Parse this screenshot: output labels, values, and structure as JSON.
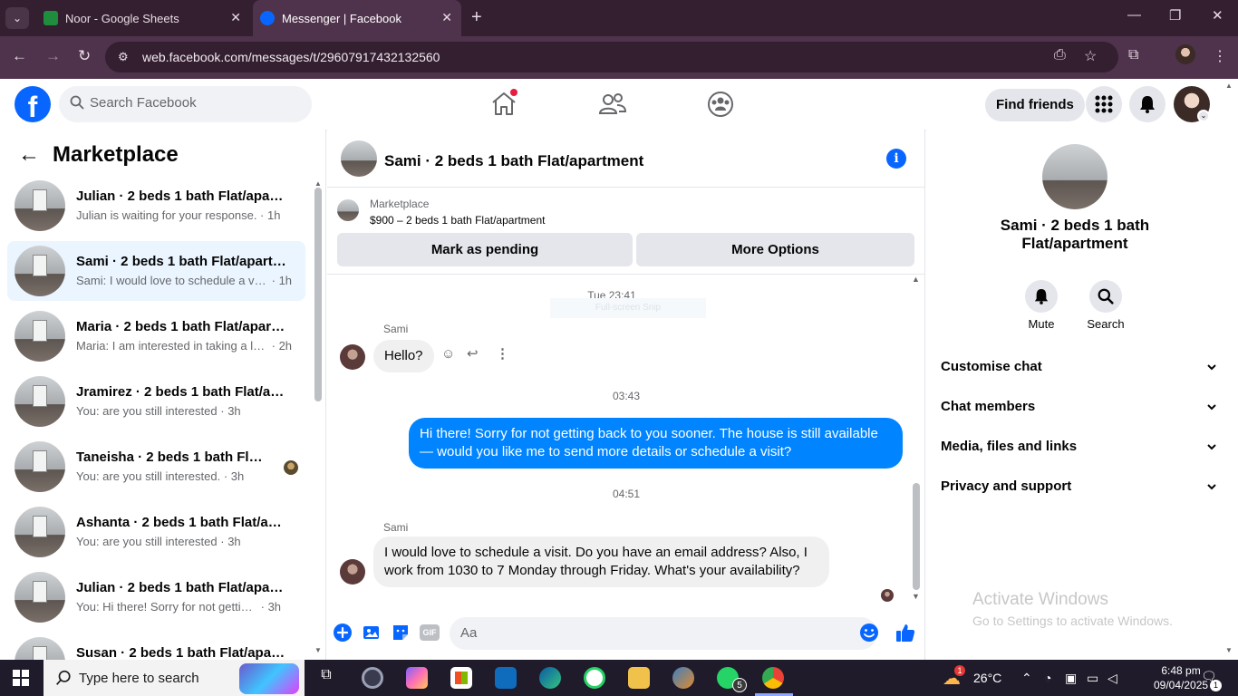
{
  "browser": {
    "tabs": [
      {
        "title": "Noor - Google Sheets"
      },
      {
        "title": "Messenger | Facebook"
      }
    ],
    "url": "web.facebook.com/messages/t/29607917432132560"
  },
  "fb_header": {
    "search_placeholder": "Search Facebook",
    "find_friends_label": "Find friends"
  },
  "sidebar": {
    "title": "Marketplace",
    "conversations": [
      {
        "name": "Julian · 2 beds 1 bath Flat/apartment",
        "snippet": "Julian is waiting for your response.",
        "time": "1h",
        "active": false
      },
      {
        "name": "Sami · 2 beds 1 bath Flat/apartment",
        "snippet": "Sami: I would love to schedule a visit.",
        "time": "1h",
        "active": true
      },
      {
        "name": "Maria · 2 beds 1 bath Flat/apartment",
        "snippet": "Maria: I am interested in taking a look",
        "time": "2h",
        "active": false
      },
      {
        "name": "Jramirez · 2 beds 1 bath Flat/apartment",
        "snippet": "You: are you still interested",
        "time": "3h",
        "active": false
      },
      {
        "name": "Taneisha · 2 beds 1 bath Flat/apartment",
        "snippet": "You: are you still interested.",
        "time": "3h",
        "active": false
      },
      {
        "name": "Ashanta · 2 beds 1 bath Flat/apartment",
        "snippet": "You: are you still interested",
        "time": "3h",
        "active": false
      },
      {
        "name": "Julian · 2 beds 1 bath Flat/apartment",
        "snippet": "You: Hi there! Sorry for not getting back to you sooner.",
        "time": "3h",
        "active": false
      },
      {
        "name": "Susan · 2 beds 1 bath Flat/apartment",
        "snippet": "",
        "time": "",
        "active": false
      }
    ]
  },
  "chat": {
    "title": "Sami · 2 beds 1 bath Flat/apartment",
    "marketplace_label": "Marketplace",
    "listing": "$900 – 2 beds 1 bath Flat/apartment",
    "mark_pending_label": "Mark as pending",
    "more_options_label": "More Options",
    "timestamps": [
      "Tue 23:41",
      "03:43",
      "04:51"
    ],
    "snip_overlay": "Full-screen Snip",
    "messages": [
      {
        "sender": "Sami",
        "text": "Hello?"
      },
      {
        "sender": "me",
        "text": "Hi there! Sorry for not getting back to you sooner. The house is still available — would you like me to send more details or schedule a visit?"
      },
      {
        "sender": "Sami",
        "text": "I would love to schedule a visit. Do you have an email address? Also, I work from 1030 to 7 Monday through Friday. What's your availability?"
      }
    ],
    "composer_placeholder": "Aa",
    "gif_label": "GIF"
  },
  "right_panel": {
    "name": "Sami · 2 beds 1 bath Flat/apartment",
    "actions": [
      {
        "label": "Mute",
        "icon": "bell-icon"
      },
      {
        "label": "Search",
        "icon": "search-icon"
      }
    ],
    "sections": [
      "Customise chat",
      "Chat members",
      "Media, files and links",
      "Privacy and support"
    ],
    "activate_title": "Activate Windows",
    "activate_sub": "Go to Settings to activate Windows."
  },
  "taskbar": {
    "search_placeholder": "Type here to search",
    "temperature": "26°C",
    "weather_badge": "1",
    "whatsapp_badge": "5",
    "time": "6:48 pm",
    "date": "09/04/2025",
    "notification_count": "1"
  },
  "colors": {
    "fb_blue": "#0866ff",
    "outgoing_bubble": "#0084ff",
    "active_conversation": "#ebf5ff",
    "chrome_frame": "#331f30"
  }
}
